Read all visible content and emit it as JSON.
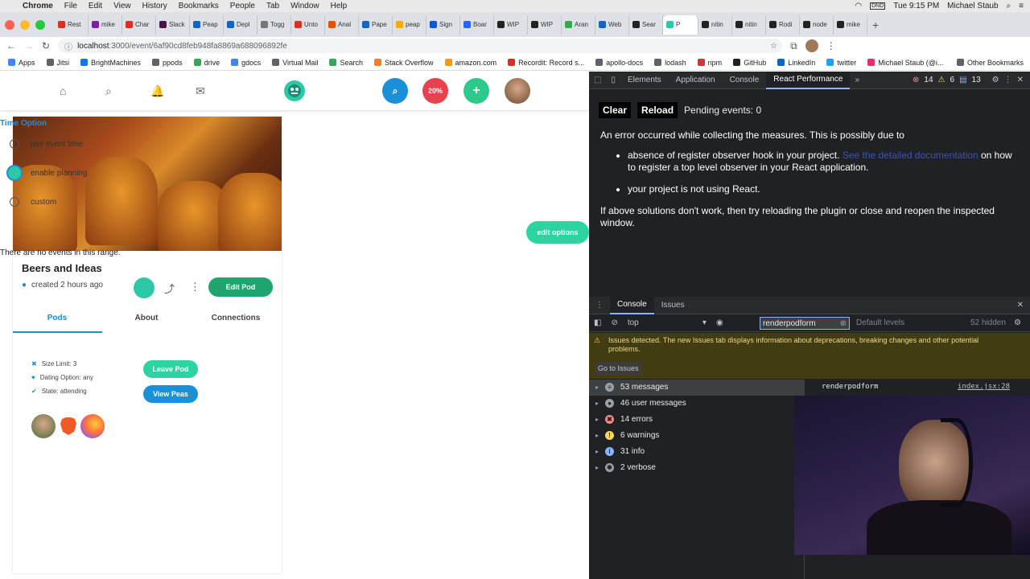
{
  "menubar": {
    "apple": "",
    "app": "Chrome",
    "items": [
      "File",
      "Edit",
      "View",
      "History",
      "Bookmarks",
      "People",
      "Tab",
      "Window",
      "Help"
    ],
    "clock": "Tue 9:15 PM",
    "user": "Michael Staub",
    "dnd": "DND"
  },
  "tabs": [
    "Rest",
    "mike",
    "Char",
    "Slack",
    "Peap",
    "Depl",
    "Togg",
    "Unto",
    "Anal",
    "Pape",
    "peap",
    "Sign",
    "Boar",
    "WIP",
    "WIP",
    "Aran",
    "Web",
    "Sear",
    "P",
    "nitin",
    "nitin",
    "Rodi",
    "node",
    "mike"
  ],
  "address": {
    "url_host": "localhost",
    "url_path": ":3000/event/6af90cd8feb948fa8869a688096892fe"
  },
  "bookmarks": [
    "Apps",
    "Jitsi",
    "BrightMachines",
    "ppods",
    "drive",
    "gdocs",
    "Virtual Mail",
    "Search",
    "Stack Overflow",
    "amazon.com",
    "Recordit: Record s...",
    "apollo-docs",
    "lodash",
    "npm",
    "GitHub",
    "LinkedIn",
    "twitter",
    "Michael Staub (@i...",
    "Other Bookmarks"
  ],
  "app": {
    "badge_percent": "20%",
    "plus": "+",
    "time_option": {
      "title": "Time Option",
      "options": [
        "use event time",
        "enable planning",
        "custom"
      ]
    },
    "no_events": "There are no events in this range.",
    "edit_options": "edit options",
    "pod": {
      "title": "Beers and Ideas",
      "created": "created 2 hours ago",
      "edit_button": "Edit Pod",
      "tabs": [
        "Pods",
        "About",
        "Connections"
      ],
      "details": [
        "Size Limit: 3",
        "Dating Option: any",
        "State: attending"
      ],
      "leave_button": "Leave Pod",
      "view_button": "View Peas"
    }
  },
  "devtools": {
    "tabs": [
      "Elements",
      "Application",
      "Console",
      "React Performance"
    ],
    "counts": {
      "errors": "14",
      "warnings": "6",
      "issues": "13"
    },
    "react_perf": {
      "clear": "Clear",
      "reload": "Reload",
      "pending": "Pending events: 0",
      "error_intro": "An error occurred while collecting the measures. This is possibly due to",
      "bullet1_pre": "absence of register observer hook in your project.",
      "bullet1_link": "See the detailed documentation",
      "bullet1_post": "on how to register a top level observer in your React application.",
      "bullet2": "your project is not using React.",
      "footer": "If above solutions don't work, then try reloading the plugin or close and reopen the inspected window."
    },
    "drawer": {
      "tabs": [
        "Console",
        "Issues"
      ],
      "context": "top",
      "filter": "renderpodform",
      "levels": "Default levels",
      "hidden": "52 hidden",
      "warning": "Issues detected. The new Issues tab displays information about deprecations, breaking changes and other potential problems.",
      "goto": "Go to Issues",
      "log_text": "renderpodform",
      "log_source": "index.jsx:28",
      "groups": [
        "53 messages",
        "46 user messages",
        "14 errors",
        "6 warnings",
        "31 info",
        "2 verbose"
      ]
    }
  }
}
